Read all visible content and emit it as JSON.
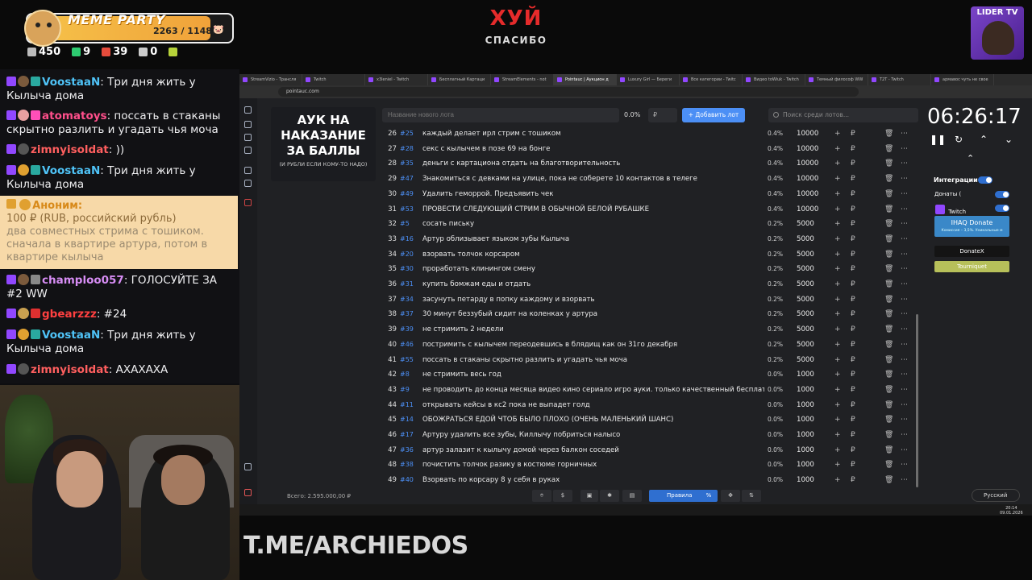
{
  "overlay": {
    "meme_title": "MEME PARTY",
    "meme_count": "2263 / 11488",
    "stats": [
      {
        "icon": "points-icon",
        "value": "450",
        "color": "#bbbbbb"
      },
      {
        "icon": "k-icon",
        "value": "9",
        "color": "#2ecc71"
      },
      {
        "icon": "u-icon",
        "value": "39",
        "color": "#e74c3c"
      },
      {
        "icon": "w-icon",
        "value": "0",
        "color": "#cccccc"
      },
      {
        "icon": "d-icon",
        "value": "",
        "color": "#b7d33a"
      }
    ],
    "center_title": "ХУЙ",
    "center_sub": "СПАСИБО",
    "lider": "LIDER TV",
    "tme": "T.ME/ARCHIEDOS"
  },
  "chat": [
    {
      "user": "VoostaaN",
      "user_color": "#4fc3f7",
      "text": "Три дня жить у Кылыча дома"
    },
    {
      "user": "atomatoys",
      "user_color": "#ff4f8b",
      "text": "поссать в стаканы скрытно разлить и угадать чья моча"
    },
    {
      "user": "zimnyisoldat",
      "user_color": "#ff5f5f",
      "text": "))"
    },
    {
      "user": "VoostaaN",
      "user_color": "#4fc3f7",
      "text": "Три дня жить у Кылыча дома"
    },
    {
      "user": "champloo057",
      "user_color": "#d78df5",
      "text": "ГОЛОСУЙТЕ ЗА #2 WW"
    },
    {
      "user": "gbearzzz",
      "user_color": "#ff4040",
      "text": "#24"
    },
    {
      "user": "VoostaaN",
      "user_color": "#4fc3f7",
      "text": "Три дня жить у Кылыча дома"
    },
    {
      "user": "zimnyisoldat",
      "user_color": "#ff5f5f",
      "text": "АХАХАХА"
    }
  ],
  "donation": {
    "name": "Аноним:",
    "amount": "100 ₽ (RUB, российский рубль)",
    "text": "два совместных стрима с тошиком. сначала в квартире артура, потом в квартире кылыча"
  },
  "browser": {
    "tabs": [
      "StreamVizio - Трансля",
      "Twitch",
      "x3leniel - Twitch",
      "Бесплатный Картаци",
      "StreamElements - not",
      "Pointauc | Аукцион д",
      "Luxury Girl — Береги",
      "Все категории - Twitc",
      "Видео toWiuk - Twitch",
      "Темный философ WW",
      "T2T - Twitch",
      "армавос чуть не свое"
    ],
    "url": "pointauc.com"
  },
  "auction": {
    "title": "АУК НА НАКАЗАНИЕ ЗА БАЛЛЫ",
    "note": "(И РУБЛИ ЕСЛИ КОМУ-ТО НАДО)",
    "lot_placeholder": "Название нового лота",
    "pct": "0.0%",
    "rub_placeholder": "₽",
    "add_label": "Добавить лот",
    "search_placeholder": "Поиск среди лотов...",
    "total": "Всего: 2.595.000,00 ₽",
    "rules_label": "Правила",
    "lang": "Русский",
    "rows": [
      {
        "n": "26",
        "id": "#25",
        "label": "каждый делает ирл стрим с тошиком",
        "pct": "0.4%",
        "amount": "10000"
      },
      {
        "n": "27",
        "id": "#28",
        "label": "секс с кылычем в позе 69 на бонге",
        "pct": "0.4%",
        "amount": "10000"
      },
      {
        "n": "28",
        "id": "#35",
        "label": "деньги с картациона отдать на благотворительность",
        "pct": "0.4%",
        "amount": "10000"
      },
      {
        "n": "29",
        "id": "#47",
        "label": "Знакомиться с девками на улице, пока не соберете 10 контактов в телеге",
        "pct": "0.4%",
        "amount": "10000"
      },
      {
        "n": "30",
        "id": "#49",
        "label": "Удалить геморрой. Предъявить чек",
        "pct": "0.4%",
        "amount": "10000"
      },
      {
        "n": "31",
        "id": "#53",
        "label": "ПРОВЕСТИ СЛЕДУЮЩИЙ СТРИМ В ОБЫЧНОЙ БЕЛОЙ РУБАШКЕ",
        "pct": "0.4%",
        "amount": "10000"
      },
      {
        "n": "32",
        "id": "#5",
        "label": "сосать письку",
        "pct": "0.2%",
        "amount": "5000"
      },
      {
        "n": "33",
        "id": "#16",
        "label": "Артур облизывает языком зубы Кылыча",
        "pct": "0.2%",
        "amount": "5000"
      },
      {
        "n": "34",
        "id": "#20",
        "label": "взорвать толчок корсаром",
        "pct": "0.2%",
        "amount": "5000"
      },
      {
        "n": "35",
        "id": "#30",
        "label": "проработать клинингом смену",
        "pct": "0.2%",
        "amount": "5000"
      },
      {
        "n": "36",
        "id": "#31",
        "label": "купить бомжам еды и отдать",
        "pct": "0.2%",
        "amount": "5000"
      },
      {
        "n": "37",
        "id": "#34",
        "label": "засунуть петарду в попку каждому и взорвать",
        "pct": "0.2%",
        "amount": "5000"
      },
      {
        "n": "38",
        "id": "#37",
        "label": "30 минут беззубый сидит на коленках у артура",
        "pct": "0.2%",
        "amount": "5000"
      },
      {
        "n": "39",
        "id": "#39",
        "label": "не стримить 2 недели",
        "pct": "0.2%",
        "amount": "5000"
      },
      {
        "n": "40",
        "id": "#46",
        "label": "постримить с кылычем переодевшись в блядищ как он 31го декабря",
        "pct": "0.2%",
        "amount": "5000"
      },
      {
        "n": "41",
        "id": "#55",
        "label": "поссать в стаканы скрытно разлить и угадать чья моча",
        "pct": "0.2%",
        "amount": "5000"
      },
      {
        "n": "42",
        "id": "#8",
        "label": "не стримить весь год",
        "pct": "0.0%",
        "amount": "1000"
      },
      {
        "n": "43",
        "id": "#9",
        "label": "не проводить до конца месяца видео кино сериало игро ауки. только качественный бесплатный ко",
        "pct": "0.0%",
        "amount": "1000"
      },
      {
        "n": "44",
        "id": "#11",
        "label": "открывать кейсы в кс2 пока не выпадет голд",
        "pct": "0.0%",
        "amount": "1000"
      },
      {
        "n": "45",
        "id": "#14",
        "label": "ОБОЖРАТЬСЯ ЕДОЙ ЧТОБ БЫЛО ПЛОХО (ОЧЕНЬ МАЛЕНЬКИЙ ШАНС)",
        "pct": "0.0%",
        "amount": "1000"
      },
      {
        "n": "46",
        "id": "#17",
        "label": "Артуру удалить все зубы, Киллычу побриться налысо",
        "pct": "0.0%",
        "amount": "1000"
      },
      {
        "n": "47",
        "id": "#36",
        "label": "артур залазит к кылычу домой через балкон соседей",
        "pct": "0.0%",
        "amount": "1000"
      },
      {
        "n": "48",
        "id": "#38",
        "label": "почистить толчок разику в костюме горничных",
        "pct": "0.0%",
        "amount": "1000"
      },
      {
        "n": "49",
        "id": "#40",
        "label": "Взорвать по корсару 8 у себя в руках",
        "pct": "0.0%",
        "amount": "1000"
      }
    ]
  },
  "timer": "06:26:17",
  "integrations": {
    "title": "Интеграции",
    "donaty": "Донаты (",
    "twitch": "Twitch",
    "ihaq": "IHAQ Donate",
    "ihaq_sub": "Комиссия – 3,5%. Уникальные м",
    "donatex": "DonateX",
    "tourniquet": "Tourniquet"
  },
  "clock": {
    "time": "20:14",
    "date": "09.01.2026"
  }
}
